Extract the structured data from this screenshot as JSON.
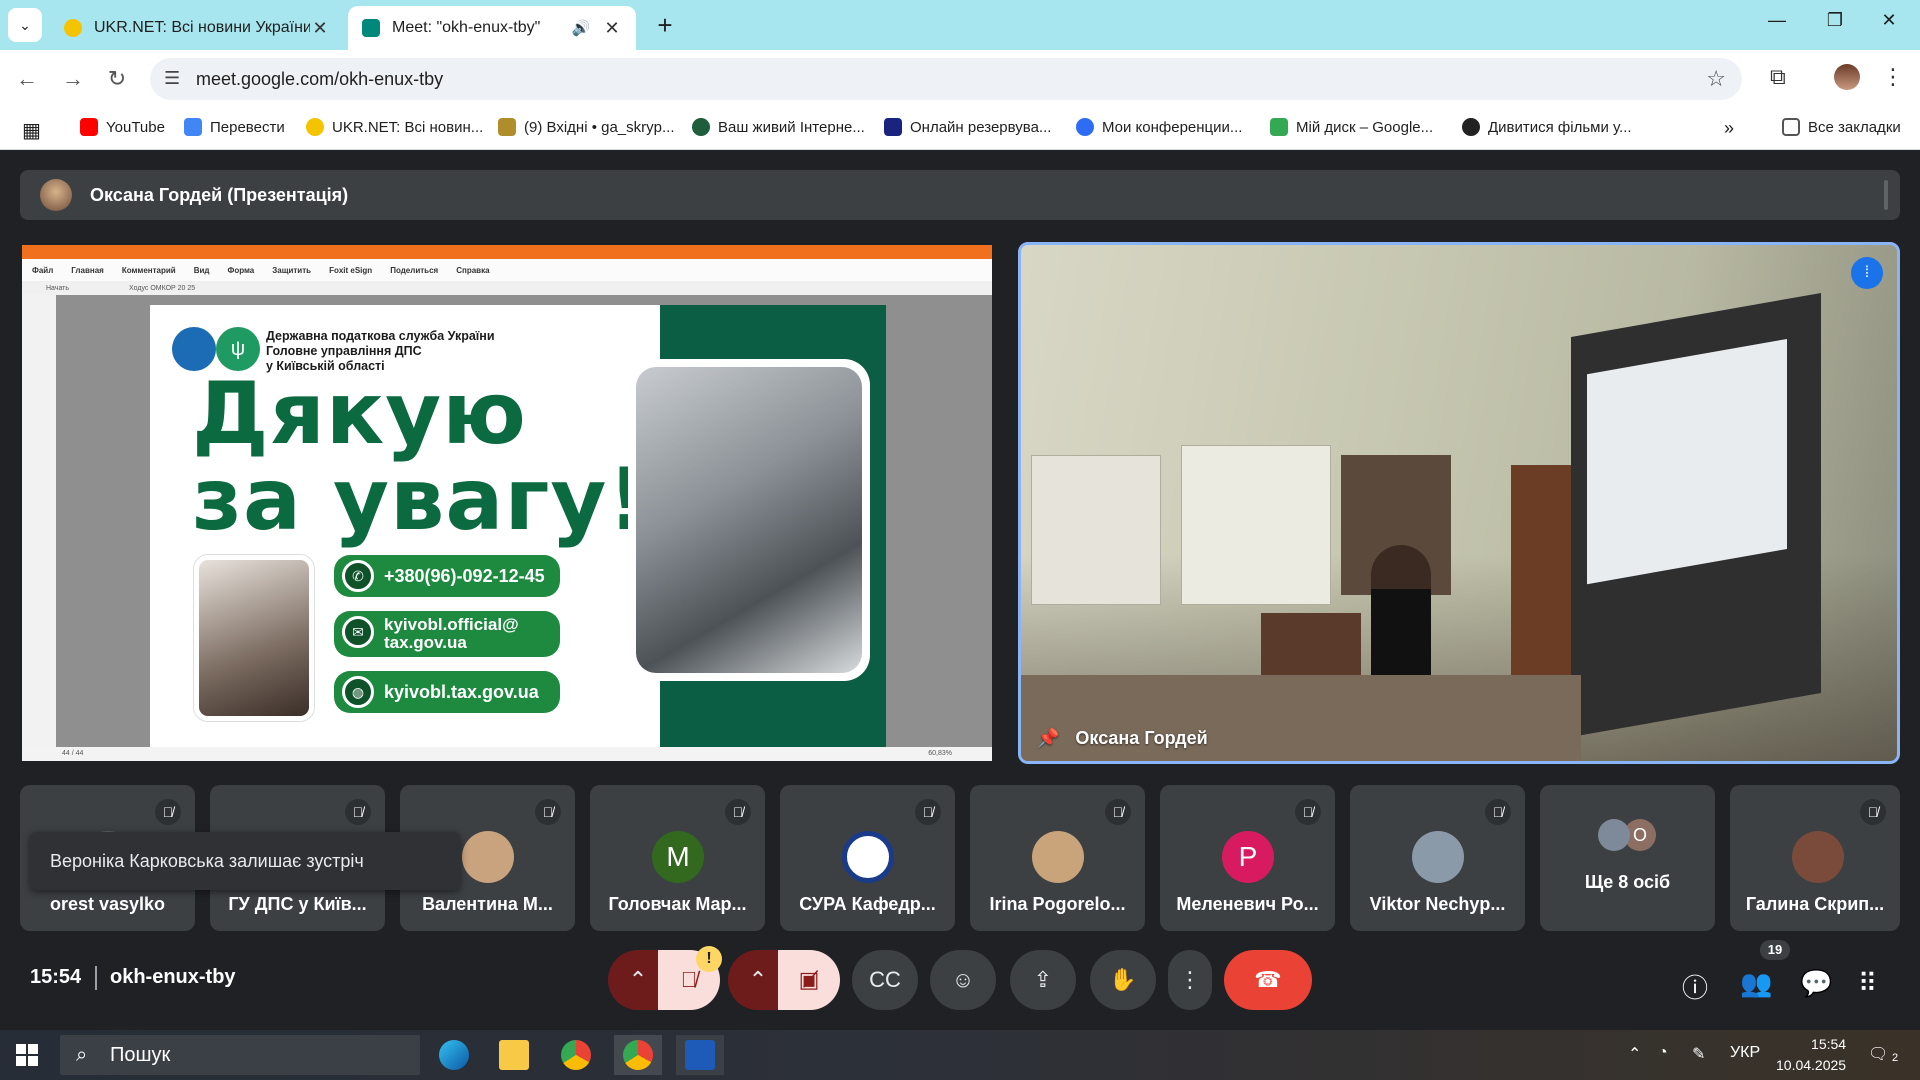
{
  "browser": {
    "tab_list_icon": "chevron-down-icon",
    "tabs": [
      {
        "label": "UKR.NET: Всі новини України, с",
        "favicon_color": "#f5c400",
        "active": false
      },
      {
        "label": "Meet: \"okh-enux-tby\"",
        "favicon_color": "#00897b",
        "active": true
      }
    ],
    "url": "meet.google.com/okh-enux-tby",
    "bookmarks": [
      {
        "label": "YouTube",
        "color": "#ff0000"
      },
      {
        "label": "Перевести",
        "color": "#4285f4"
      },
      {
        "label": "UKR.NET: Всі новин...",
        "color": "#f5c400"
      },
      {
        "label": "(9) Вхідні • ga_skryp...",
        "color": "#b08d2b"
      },
      {
        "label": "Ваш живий Інтерне...",
        "color": "#1e5e3a"
      },
      {
        "label": "Онлайн резервува...",
        "color": "#1a237e"
      },
      {
        "label": "Мои конференции...",
        "color": "#2d6cf5"
      },
      {
        "label": "Мій диск – Google...",
        "color": "#34a853"
      },
      {
        "label": "Дивитися фільми у...",
        "color": "#222222"
      }
    ],
    "all_bookmarks": "Все закладки"
  },
  "meet": {
    "presenter_bar": "Оксана Гордей (Презентація)",
    "shared_screen": {
      "menu": [
        "Файл",
        "Главная",
        "Комментарий",
        "Вид",
        "Форма",
        "Защитить",
        "Foxit eSign",
        "Поделиться",
        "Справка"
      ],
      "tabs": [
        "Начать",
        "Ходус ОМКОР 20 25"
      ],
      "page_indicator": "44 / 44",
      "zoom": "60,83%",
      "slide": {
        "org_line1": "Державна податкова служба України",
        "org_line2": "Головне управління ДПС",
        "org_line3": "у Київській області",
        "thanks_line1": "Дякую",
        "thanks_line2": "за увагу!",
        "phone": "+380(96)-092-12-45",
        "email_line1": "kyivobl.official@",
        "email_line2": "tax.gov.ua",
        "site": "kyivobl.tax.gov.ua"
      }
    },
    "video_name": "Оксана Гордей",
    "participants": [
      {
        "name": "orest vasylko",
        "initial": "",
        "color": "#5f6368"
      },
      {
        "name": "ГУ ДПС у Київ...",
        "initial": "",
        "color": "#5f6368"
      },
      {
        "name": "Валентина М...",
        "initial": "",
        "color": "#c9a27e"
      },
      {
        "name": "Головчак Мар...",
        "initial": "M",
        "color": "#33691e"
      },
      {
        "name": "СУРА Кафедр...",
        "initial": "",
        "color": "#1a3a8a"
      },
      {
        "name": "Irina Pogorelo...",
        "initial": "",
        "color": "#c9a37a"
      },
      {
        "name": "Меленевич Ро...",
        "initial": "P",
        "color": "#d81b60"
      },
      {
        "name": "Viktor Nechyp...",
        "initial": "",
        "color": "#8a9aa8"
      },
      {
        "name": "Ще 8 осіб",
        "initial": "O",
        "color": "#8d6e63"
      },
      {
        "name": "Галина Скрип...",
        "initial": "",
        "color": "#7a4a3a"
      }
    ],
    "toast": "Вероніка Карковська залишає зустріч",
    "clock": "15:54",
    "meeting_code": "okh-enux-tby",
    "people_count": "19",
    "warning_badge": "!"
  },
  "taskbar": {
    "search_placeholder": "Пошук",
    "lang": "УКР",
    "time": "15:54",
    "date": "10.04.2025",
    "notifications": "2"
  }
}
